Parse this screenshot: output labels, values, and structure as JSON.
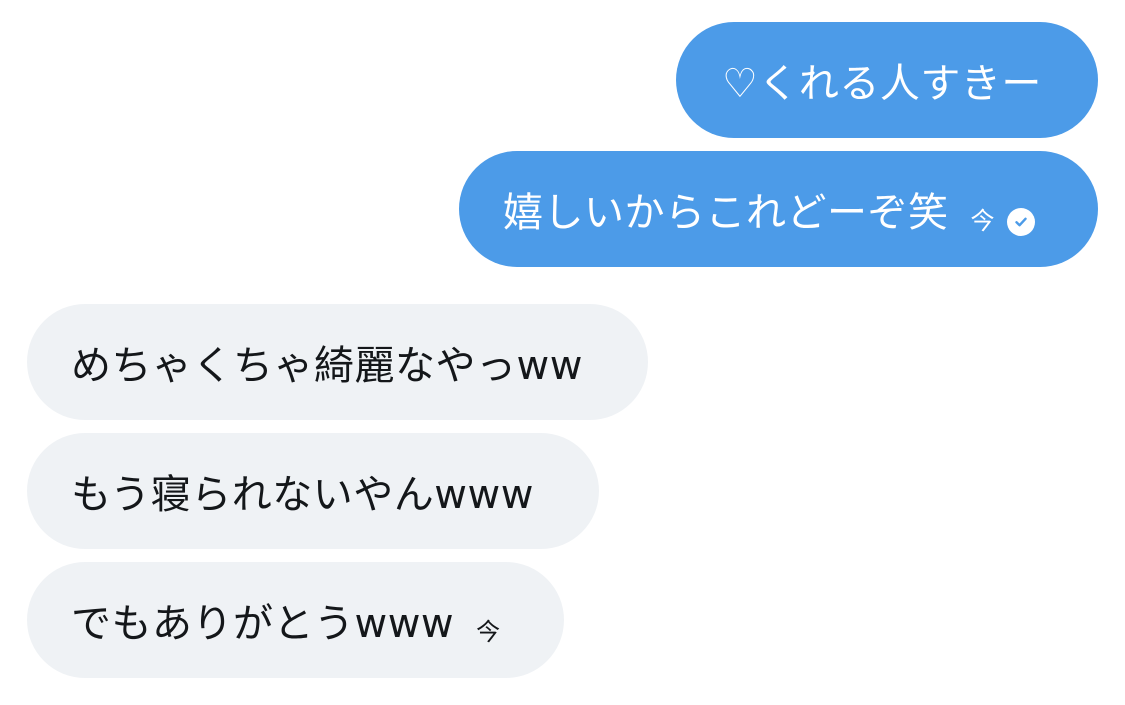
{
  "messages": [
    {
      "text": "♡くれる人すきー"
    },
    {
      "text": "嬉しいからこれどーぞ笑",
      "time": "今",
      "status_icon": "read-check-icon"
    },
    {
      "text": "めちゃくちゃ綺麗なやっww"
    },
    {
      "text": "もう寝られないやんwww"
    },
    {
      "text": "でもありがとうwww",
      "time": "今"
    }
  ],
  "colors": {
    "sent_bubble": "#4c9be8",
    "received_bubble": "#eff2f5",
    "sent_text": "#ffffff",
    "received_text": "#14171a"
  }
}
